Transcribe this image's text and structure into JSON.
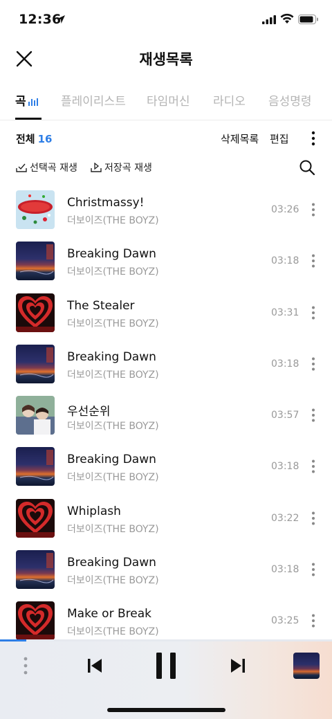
{
  "status_bar": {
    "time": "12:36"
  },
  "header": {
    "title": "재생목록"
  },
  "tabs": [
    {
      "label": "곡",
      "active": true
    },
    {
      "label": "플레이리스트",
      "active": false
    },
    {
      "label": "타임머신",
      "active": false
    },
    {
      "label": "라디오",
      "active": false
    },
    {
      "label": "음성명령",
      "active": false
    }
  ],
  "list_header": {
    "total_label": "전체",
    "total_count": "16",
    "delete_list_label": "삭제목록",
    "edit_label": "편집"
  },
  "controls": {
    "play_selected_label": "선택곡 재생",
    "play_saved_label": "저장곡 재생"
  },
  "songs": [
    {
      "title": "Christmassy!",
      "artist": "더보이즈(THE BOYZ)",
      "duration": "03:26",
      "art": "xmas"
    },
    {
      "title": "Breaking Dawn",
      "artist": "더보이즈(THE BOYZ)",
      "duration": "03:18",
      "art": "dawn"
    },
    {
      "title": "The Stealer",
      "artist": "더보이즈(THE BOYZ)",
      "duration": "03:31",
      "art": "heart"
    },
    {
      "title": "Breaking Dawn",
      "artist": "더보이즈(THE BOYZ)",
      "duration": "03:18",
      "art": "dawn"
    },
    {
      "title": "우선순위",
      "artist": "더보이즈(THE BOYZ)",
      "duration": "03:57",
      "art": "photo"
    },
    {
      "title": "Breaking Dawn",
      "artist": "더보이즈(THE BOYZ)",
      "duration": "03:18",
      "art": "dawn"
    },
    {
      "title": "Whiplash",
      "artist": "더보이즈(THE BOYZ)",
      "duration": "03:22",
      "art": "heart"
    },
    {
      "title": "Breaking Dawn",
      "artist": "더보이즈(THE BOYZ)",
      "duration": "03:18",
      "art": "dawn"
    },
    {
      "title": "Make or Break",
      "artist": "더보이즈(THE BOYZ)",
      "duration": "03:25",
      "art": "heart"
    }
  ],
  "player": {
    "progress_fraction": 0.08,
    "now_playing_art": "dawn"
  },
  "colors": {
    "accent": "#2e7ee6",
    "text": "#111111",
    "muted": "#999999",
    "tab_inactive": "#b4b4b4"
  }
}
